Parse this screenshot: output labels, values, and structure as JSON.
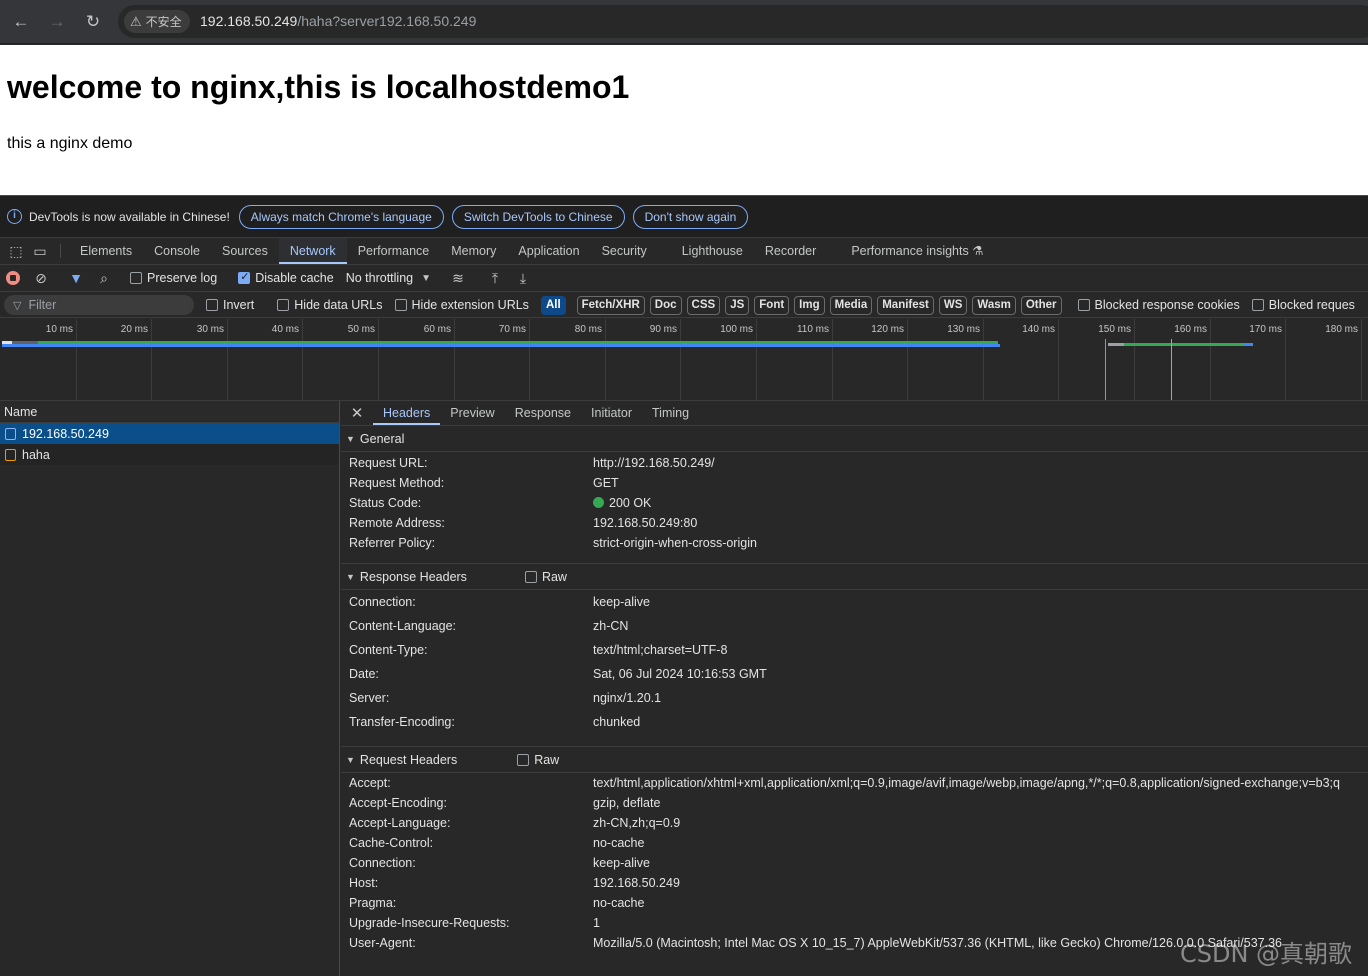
{
  "browser": {
    "security_label": "不安全",
    "url_host": "192.168.50.249",
    "url_path": "/haha?server192.168.50.249"
  },
  "page": {
    "heading": "welcome to nginx,this is localhostdemo1",
    "text": "this a nginx demo"
  },
  "infobar": {
    "message": "DevTools is now available in Chinese!",
    "btn_match": "Always match Chrome's language",
    "btn_switch": "Switch DevTools to Chinese",
    "btn_dismiss": "Don't show again"
  },
  "tabs": [
    "Elements",
    "Console",
    "Sources",
    "Network",
    "Performance",
    "Memory",
    "Application",
    "Security",
    "Lighthouse",
    "Recorder",
    "Performance insights"
  ],
  "toolbar": {
    "preserve_log": "Preserve log",
    "disable_cache": "Disable cache",
    "throttling": "No throttling"
  },
  "filterbar": {
    "placeholder": "Filter",
    "invert": "Invert",
    "hide_data_urls": "Hide data URLs",
    "hide_ext_urls": "Hide extension URLs",
    "chips": [
      "All",
      "Fetch/XHR",
      "Doc",
      "CSS",
      "JS",
      "Font",
      "Img",
      "Media",
      "Manifest",
      "WS",
      "Wasm",
      "Other"
    ],
    "blocked_cookies": "Blocked response cookies",
    "blocked_requests": "Blocked reques"
  },
  "timeline": {
    "ticks": [
      "10 ms",
      "20 ms",
      "30 ms",
      "40 ms",
      "50 ms",
      "60 ms",
      "70 ms",
      "80 ms",
      "90 ms",
      "100 ms",
      "110 ms",
      "120 ms",
      "130 ms",
      "140 ms",
      "150 ms",
      "160 ms",
      "170 ms",
      "180 ms"
    ],
    "colors": {
      "waiting": "#34a853",
      "download": "#4285f4",
      "load": "#ff7043",
      "dcl": "#4fc3f7"
    }
  },
  "requests": {
    "header": "Name",
    "rows": [
      {
        "name": "192.168.50.249",
        "type": "document"
      },
      {
        "name": "haha",
        "type": "xhr"
      }
    ]
  },
  "details": {
    "subtabs": [
      "Headers",
      "Preview",
      "Response",
      "Initiator",
      "Timing"
    ],
    "general": {
      "title": "General",
      "rows": [
        {
          "k": "Request URL:",
          "v": "http://192.168.50.249/"
        },
        {
          "k": "Request Method:",
          "v": "GET"
        },
        {
          "k": "Status Code:",
          "v": "200 OK"
        },
        {
          "k": "Remote Address:",
          "v": "192.168.50.249:80"
        },
        {
          "k": "Referrer Policy:",
          "v": "strict-origin-when-cross-origin"
        }
      ]
    },
    "response": {
      "title": "Response Headers",
      "raw": "Raw",
      "rows": [
        {
          "k": "Connection:",
          "v": "keep-alive"
        },
        {
          "k": "Content-Language:",
          "v": "zh-CN"
        },
        {
          "k": "Content-Type:",
          "v": "text/html;charset=UTF-8"
        },
        {
          "k": "Date:",
          "v": "Sat, 06 Jul 2024 10:16:53 GMT"
        },
        {
          "k": "Server:",
          "v": "nginx/1.20.1"
        },
        {
          "k": "Transfer-Encoding:",
          "v": "chunked"
        }
      ]
    },
    "request": {
      "title": "Request Headers",
      "raw": "Raw",
      "rows": [
        {
          "k": "Accept:",
          "v": "text/html,application/xhtml+xml,application/xml;q=0.9,image/avif,image/webp,image/apng,*/*;q=0.8,application/signed-exchange;v=b3;q"
        },
        {
          "k": "Accept-Encoding:",
          "v": "gzip, deflate"
        },
        {
          "k": "Accept-Language:",
          "v": "zh-CN,zh;q=0.9"
        },
        {
          "k": "Cache-Control:",
          "v": "no-cache"
        },
        {
          "k": "Connection:",
          "v": "keep-alive"
        },
        {
          "k": "Host:",
          "v": "192.168.50.249"
        },
        {
          "k": "Pragma:",
          "v": "no-cache"
        },
        {
          "k": "Upgrade-Insecure-Requests:",
          "v": "1"
        },
        {
          "k": "User-Agent:",
          "v": "Mozilla/5.0 (Macintosh; Intel Mac OS X 10_15_7) AppleWebKit/537.36 (KHTML, like Gecko) Chrome/126.0.0.0 Safari/537.36"
        }
      ]
    }
  },
  "watermark": "CSDN @真朝歌"
}
